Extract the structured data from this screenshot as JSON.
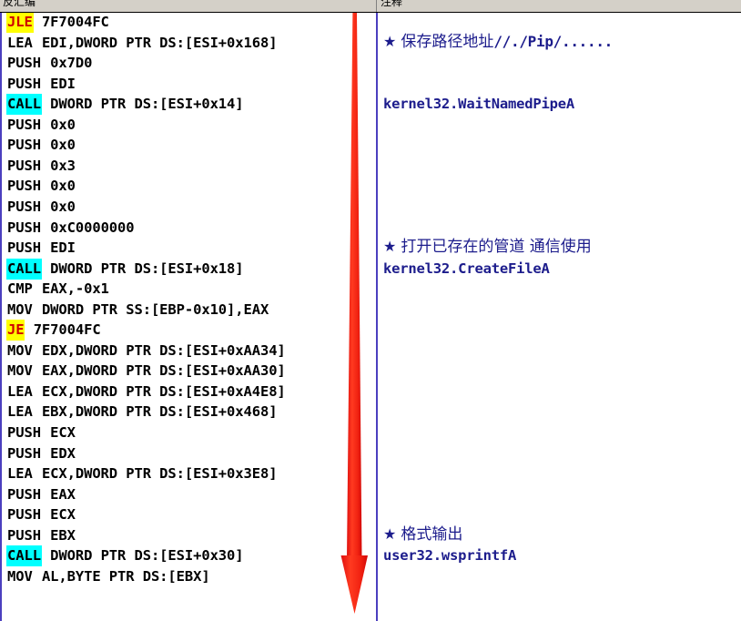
{
  "window": {
    "title": "disassembly-view"
  },
  "columns": {
    "disassembly_header": "反汇编",
    "comment_header": "注释"
  },
  "colors": {
    "jump_highlight_bg": "#ffff00",
    "jump_text": "#d00000",
    "call_highlight_bg": "#00ffff",
    "call_text": "#000000",
    "comment_text": "#1c1c8c",
    "arrow": "#f42020",
    "pane_border": "#4b3fbf",
    "header_bg": "#d4d0c8"
  },
  "disassembly": {
    "rows": [
      {
        "mnemonic": "JLE",
        "operands": "7F7004FC",
        "highlight": "jump"
      },
      {
        "mnemonic": "LEA",
        "operands": "EDI,DWORD PTR DS:[ESI+0x168]",
        "highlight": "none"
      },
      {
        "mnemonic": "PUSH",
        "operands": "0x7D0",
        "highlight": "none"
      },
      {
        "mnemonic": "PUSH",
        "operands": "EDI",
        "highlight": "none"
      },
      {
        "mnemonic": "CALL",
        "operands": "DWORD PTR DS:[ESI+0x14]",
        "highlight": "call"
      },
      {
        "mnemonic": "PUSH",
        "operands": "0x0",
        "highlight": "none"
      },
      {
        "mnemonic": "PUSH",
        "operands": "0x0",
        "highlight": "none"
      },
      {
        "mnemonic": "PUSH",
        "operands": "0x3",
        "highlight": "none"
      },
      {
        "mnemonic": "PUSH",
        "operands": "0x0",
        "highlight": "none"
      },
      {
        "mnemonic": "PUSH",
        "operands": "0x0",
        "highlight": "none"
      },
      {
        "mnemonic": "PUSH",
        "operands": "0xC0000000",
        "highlight": "none"
      },
      {
        "mnemonic": "PUSH",
        "operands": "EDI",
        "highlight": "none"
      },
      {
        "mnemonic": "CALL",
        "operands": "DWORD PTR DS:[ESI+0x18]",
        "highlight": "call"
      },
      {
        "mnemonic": "CMP",
        "operands": "EAX,-0x1",
        "highlight": "none"
      },
      {
        "mnemonic": "MOV",
        "operands": "DWORD PTR SS:[EBP-0x10],EAX",
        "highlight": "none"
      },
      {
        "mnemonic": "JE",
        "operands": "7F7004FC",
        "highlight": "jump"
      },
      {
        "mnemonic": "MOV",
        "operands": "EDX,DWORD PTR DS:[ESI+0xAA34]",
        "highlight": "none"
      },
      {
        "mnemonic": "MOV",
        "operands": "EAX,DWORD PTR DS:[ESI+0xAA30]",
        "highlight": "none"
      },
      {
        "mnemonic": "LEA",
        "operands": "ECX,DWORD PTR DS:[ESI+0xA4E8]",
        "highlight": "none"
      },
      {
        "mnemonic": "LEA",
        "operands": "EBX,DWORD PTR DS:[ESI+0x468]",
        "highlight": "none"
      },
      {
        "mnemonic": "PUSH",
        "operands": "ECX",
        "highlight": "none"
      },
      {
        "mnemonic": "PUSH",
        "operands": "EDX",
        "highlight": "none"
      },
      {
        "mnemonic": "LEA",
        "operands": "ECX,DWORD PTR DS:[ESI+0x3E8]",
        "highlight": "none"
      },
      {
        "mnemonic": "PUSH",
        "operands": "EAX",
        "highlight": "none"
      },
      {
        "mnemonic": "PUSH",
        "operands": "ECX",
        "highlight": "none"
      },
      {
        "mnemonic": "PUSH",
        "operands": "EBX",
        "highlight": "none"
      },
      {
        "mnemonic": "CALL",
        "operands": "DWORD PTR DS:[ESI+0x30]",
        "highlight": "call"
      },
      {
        "mnemonic": "MOV",
        "operands": "AL,BYTE PTR DS:[EBX]",
        "highlight": "none"
      }
    ]
  },
  "comments": {
    "notes": [
      {
        "star": "★",
        "chinese": "保存路径地址",
        "path": "//./Pip/......",
        "api": "kernel32.WaitNamedPipeA",
        "row_index": 1,
        "api_row_index": 4
      },
      {
        "star": "★",
        "chinese": "打开已存在的管道 通信使用",
        "path": "",
        "api": "kernel32.CreateFileA",
        "row_index": 11,
        "api_row_index": 12
      },
      {
        "star": "★",
        "chinese": "格式输出",
        "path": "",
        "api": "user32.wsprintfA",
        "row_index": 25,
        "api_row_index": 26
      }
    ]
  },
  "annotation_arrow": {
    "name": "red-down-arrow",
    "direction": "down"
  }
}
